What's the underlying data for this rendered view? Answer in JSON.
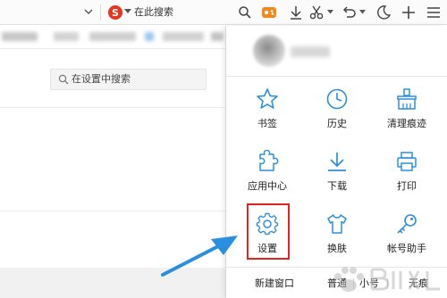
{
  "toolbar": {
    "search_placeholder": "在此搜索",
    "accent_orange": "#f08a1c",
    "engine_color": "#e8341c",
    "icons": [
      "chevron-down-icon",
      "sogou-search-engine-icon",
      "search-icon",
      "game-controller-icon",
      "download-icon",
      "scissors-icon",
      "undo-icon",
      "night-mode-icon",
      "add-tab-icon",
      "menu-icon"
    ]
  },
  "settings_pane": {
    "search_placeholder": "在设置中搜索"
  },
  "menu": {
    "items": [
      {
        "label": "书签",
        "icon": "star-icon"
      },
      {
        "label": "历史",
        "icon": "clock-icon"
      },
      {
        "label": "清理痕迹",
        "icon": "broom-icon"
      },
      {
        "label": "应用中心",
        "icon": "puzzle-icon"
      },
      {
        "label": "下载",
        "icon": "download-icon"
      },
      {
        "label": "打印",
        "icon": "printer-icon"
      },
      {
        "label": "设置",
        "icon": "gear-icon"
      },
      {
        "label": "换肤",
        "icon": "tshirt-icon"
      },
      {
        "label": "帐号助手",
        "icon": "key-icon"
      }
    ],
    "icon_color": "#2c8fdc",
    "bottom": {
      "new_window": "新建窗口",
      "mode_normal": "普通",
      "mode_small": "小号",
      "mode_incognito": "无痕"
    }
  },
  "annotation": {
    "highlight_color": "#e0231e",
    "arrow_color": "#2a8fe0"
  }
}
